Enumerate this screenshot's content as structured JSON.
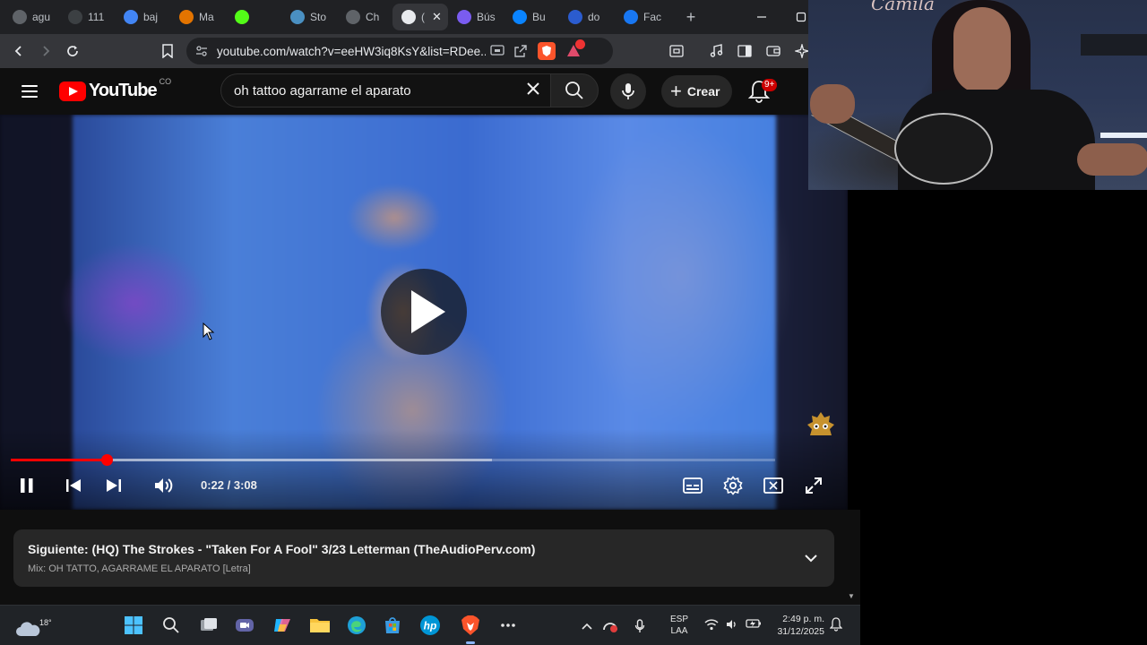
{
  "browser": {
    "tabs": [
      {
        "label": "agu",
        "fav": "globe-icon",
        "color": "#5f6368"
      },
      {
        "label": "111",
        "fav": "tiktok-icon",
        "color": "#3c4043"
      },
      {
        "label": "baj",
        "fav": "google-icon",
        "color": "#4285f4"
      },
      {
        "label": "Ma",
        "fav": "brave-talk-icon",
        "color": "#e37400"
      },
      {
        "label": "",
        "fav": "kick-icon",
        "color": "#53fc18"
      },
      {
        "label": "Sto",
        "fav": "globe-icon",
        "color": "#4a90c2"
      },
      {
        "label": "Ch",
        "fav": "chatgpt-icon",
        "color": "#5f6368"
      },
      {
        "label": "(",
        "fav": "speaker-icon",
        "color": "#e8eaed",
        "active": true
      },
      {
        "label": "Bús",
        "fav": "copilot-icon",
        "color": "#7a5cf0"
      },
      {
        "label": "Bu",
        "fav": "onedrive-icon",
        "color": "#0a84ff"
      },
      {
        "label": "do",
        "fav": "word-icon",
        "color": "#2b5ccf"
      },
      {
        "label": "Fac",
        "fav": "facebook-icon",
        "color": "#1877f2"
      }
    ],
    "new_tab_label": "+",
    "url": "youtube.com/watch?v=eeHW3iq8KsY&list=RDee..."
  },
  "youtube": {
    "logo_text": "YouTube",
    "country_code": "CO",
    "search_query": "oh tattoo agarrame el aparato",
    "create_label": "Crear",
    "notification_count": "9+"
  },
  "player": {
    "time_current": "0:22",
    "time_total": "3:08",
    "time_display": "0:22 / 3:08",
    "played_fraction": 0.126,
    "loaded_fraction": 0.63
  },
  "up_next": {
    "title": "Siguiente: (HQ) The Strokes - \"Taken For A Fool\" 3/23 Letterman (TheAudioPerv.com)",
    "subtitle": "Mix: OH TATTO, AGARRAME EL APARATO [Letra]"
  },
  "taskbar": {
    "weather_temp": "18°",
    "lang_line1": "ESP",
    "lang_line2": "LAA",
    "time": "2:49 p. m.",
    "date": "31/12/2025"
  },
  "webcam": {
    "sign_text": "Camila"
  }
}
